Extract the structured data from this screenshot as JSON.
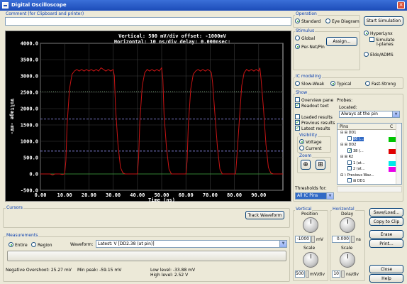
{
  "window": {
    "title": "Digital Oscilloscope"
  },
  "comment": {
    "label": "Comment (for Clipboard and printer)",
    "value": ""
  },
  "scope": {
    "header_line1": "Vertical: 500 mV/div  offset: -1000mV",
    "header_line2": "Horizontal: 10 ns/div  delay: 0.000nsec:",
    "ylabel": "Voltage -mV-",
    "xlabel": "Time  (ns)",
    "yticks": [
      "4000.0",
      "3500.0",
      "3000.0",
      "2500.0",
      "2000.0",
      "1500.0",
      "1000.0",
      "500.0",
      "0.0",
      "-500.0"
    ],
    "xticks": [
      "0.00",
      "10.00",
      "20.00",
      "30.00",
      "40.00",
      "50.00",
      "60.00",
      "70.00",
      "80.00",
      "90.00"
    ]
  },
  "chart_data": {
    "type": "line",
    "xlabel": "Time (ns)",
    "ylabel": "Voltage mV",
    "xlim": [
      0,
      100
    ],
    "ylim": [
      -500,
      4000
    ],
    "grid": true,
    "series": [
      {
        "color": "#c81414",
        "x": [
          0,
          3,
          4,
          5,
          6,
          7,
          8,
          9,
          10,
          10.5,
          11,
          12,
          13,
          14,
          15,
          16,
          17,
          18,
          19,
          20,
          21,
          22,
          23,
          24,
          25,
          26,
          27,
          28,
          29,
          30,
          30.5,
          31,
          32,
          33,
          34,
          35,
          36,
          37,
          38,
          39,
          40,
          40.5,
          41,
          42,
          43,
          44,
          45,
          46,
          47,
          48,
          49,
          50,
          50.5,
          51,
          52,
          53,
          54,
          55,
          56,
          57,
          58,
          59,
          60,
          60.5,
          61,
          62,
          63,
          64,
          65,
          66,
          67,
          68,
          69,
          70,
          70.5,
          71,
          72,
          73,
          74,
          75,
          76,
          77,
          78,
          79,
          80,
          80.5,
          81,
          82,
          83,
          84,
          85,
          86,
          87,
          88,
          89,
          90,
          90.5,
          91,
          92,
          93,
          94,
          95,
          96,
          97,
          98,
          99,
          100
        ],
        "y": [
          0,
          0,
          0,
          -30,
          0,
          0,
          0,
          -20,
          0,
          400,
          1500,
          2600,
          3050,
          3150,
          3200,
          3150,
          3200,
          3150,
          3200,
          3150,
          3200,
          3150,
          3200,
          3150,
          3250,
          3200,
          3150,
          3200,
          3150,
          3200,
          3000,
          2000,
          900,
          200,
          30,
          0,
          0,
          0,
          0,
          0,
          0,
          500,
          1600,
          2700,
          3100,
          3200,
          3150,
          3200,
          3150,
          3200,
          3150,
          3250,
          2900,
          1800,
          800,
          150,
          0,
          0,
          0,
          0,
          0,
          0,
          0,
          400,
          1500,
          2600,
          3050,
          3150,
          3200,
          3150,
          3200,
          3150,
          3200,
          3150,
          3100,
          2800,
          1800,
          800,
          150,
          0,
          0,
          0,
          0,
          0,
          0,
          0,
          500,
          1600,
          2700,
          3100,
          3200,
          3150,
          3200,
          3150,
          3200,
          3150,
          3250,
          2900,
          2000,
          900,
          200,
          30,
          0,
          0,
          0,
          0,
          0
        ]
      }
    ],
    "reference_lines": [
      {
        "y": 2520,
        "color": "#7fb07f",
        "style": "dotted"
      },
      {
        "y": 1680,
        "color": "#9a9aff",
        "style": "dashed"
      },
      {
        "y": 700,
        "color": "#9a9aff",
        "style": "dashed"
      },
      {
        "y": 0,
        "color": "#3aa03a",
        "style": "solid"
      }
    ]
  },
  "operation": {
    "title": "Operation",
    "standard": "Standard",
    "eye": "Eye Diagram",
    "start": "Start Simulation"
  },
  "stimulus": {
    "title": "Stimulus",
    "global": "Global",
    "per_net": "Per-Net/Pin",
    "assign": "Assign...",
    "hyperlynx": "HyperLynx",
    "simulate": "Simulate",
    "planes": "I-planes",
    "eldo": "Eldo/ADMS"
  },
  "ic_modeling": {
    "title": "IC modeling",
    "slow": "Slow-Weak",
    "typical": "Typical",
    "fast": "Fast-Strong"
  },
  "show": {
    "title": "Show",
    "overview": "Overview pane",
    "readout": "Readout text",
    "loaded": "Loaded results",
    "previous": "Previous results",
    "latest": "Latest results"
  },
  "visibility": {
    "title": "Visibility",
    "voltage": "Voltage",
    "current": "Current"
  },
  "zoom": {
    "title": "Zoom"
  },
  "probes": {
    "title": "Probes:",
    "located_label": "Located:",
    "located_value": "Always at the pin",
    "col_pins": "Pins",
    "col_c": "C",
    "tree": [
      {
        "label": "DD1",
        "indent": 0,
        "icon": "chip",
        "swatch": ""
      },
      {
        "label": "86 (...",
        "indent": 1,
        "icon": "pin",
        "swatch": "#00c400",
        "checked": false,
        "selected": true
      },
      {
        "label": "DD2",
        "indent": 0,
        "icon": "chip",
        "swatch": ""
      },
      {
        "label": "38 (...",
        "indent": 1,
        "icon": "pin",
        "swatch": "#e00000",
        "checked": true
      },
      {
        "label": "R2",
        "indent": 0,
        "icon": "chip",
        "swatch": ""
      },
      {
        "label": "1 (at...",
        "indent": 1,
        "icon": "pin",
        "swatch": "#00e8e8",
        "checked": false
      },
      {
        "label": "2 (at...",
        "indent": 1,
        "icon": "pin",
        "swatch": "#e800e8",
        "checked": false
      },
      {
        "label": "Previous Wav...",
        "indent": 0,
        "icon": "wave",
        "swatch": ""
      },
      {
        "label": "DD1",
        "indent": 1,
        "icon": "chip",
        "swatch": ""
      }
    ]
  },
  "thresholds": {
    "label": "Thresholds for:",
    "value": "All IC Pins"
  },
  "cursors": {
    "title": "Cursors",
    "track": "Track Waveform"
  },
  "vertical": {
    "title": "Vertical",
    "position_label": "Position",
    "position_value": "-1000",
    "position_unit": "mV",
    "scale_label": "Scale",
    "scale_value": "500",
    "scale_unit": "mV/div"
  },
  "horizontal": {
    "title": "Horizontal",
    "delay_label": "Delay",
    "delay_value": "0.000",
    "delay_unit": "ns",
    "scale_label": "Scale",
    "scale_value": "10",
    "scale_unit": "ns/div"
  },
  "side_buttons": {
    "save_load": "Save/Load...",
    "copy": "Copy to Clip",
    "erase": "Erase",
    "print": "Print...",
    "close": "Close",
    "help": "Help"
  },
  "measurements": {
    "title": "Measurements",
    "entire": "Entire",
    "region": "Region",
    "waveform_label": "Waveform:",
    "waveform_value": "Latest: V [DD2.38 (at pin)]",
    "neg_overshoot": "Negative Overshoot: 25.27 mV",
    "min_peak": "Min peak: -59.15 mV",
    "low_level": "Low level: -33.88 mV",
    "high_level": "High level: 2.52 V"
  }
}
